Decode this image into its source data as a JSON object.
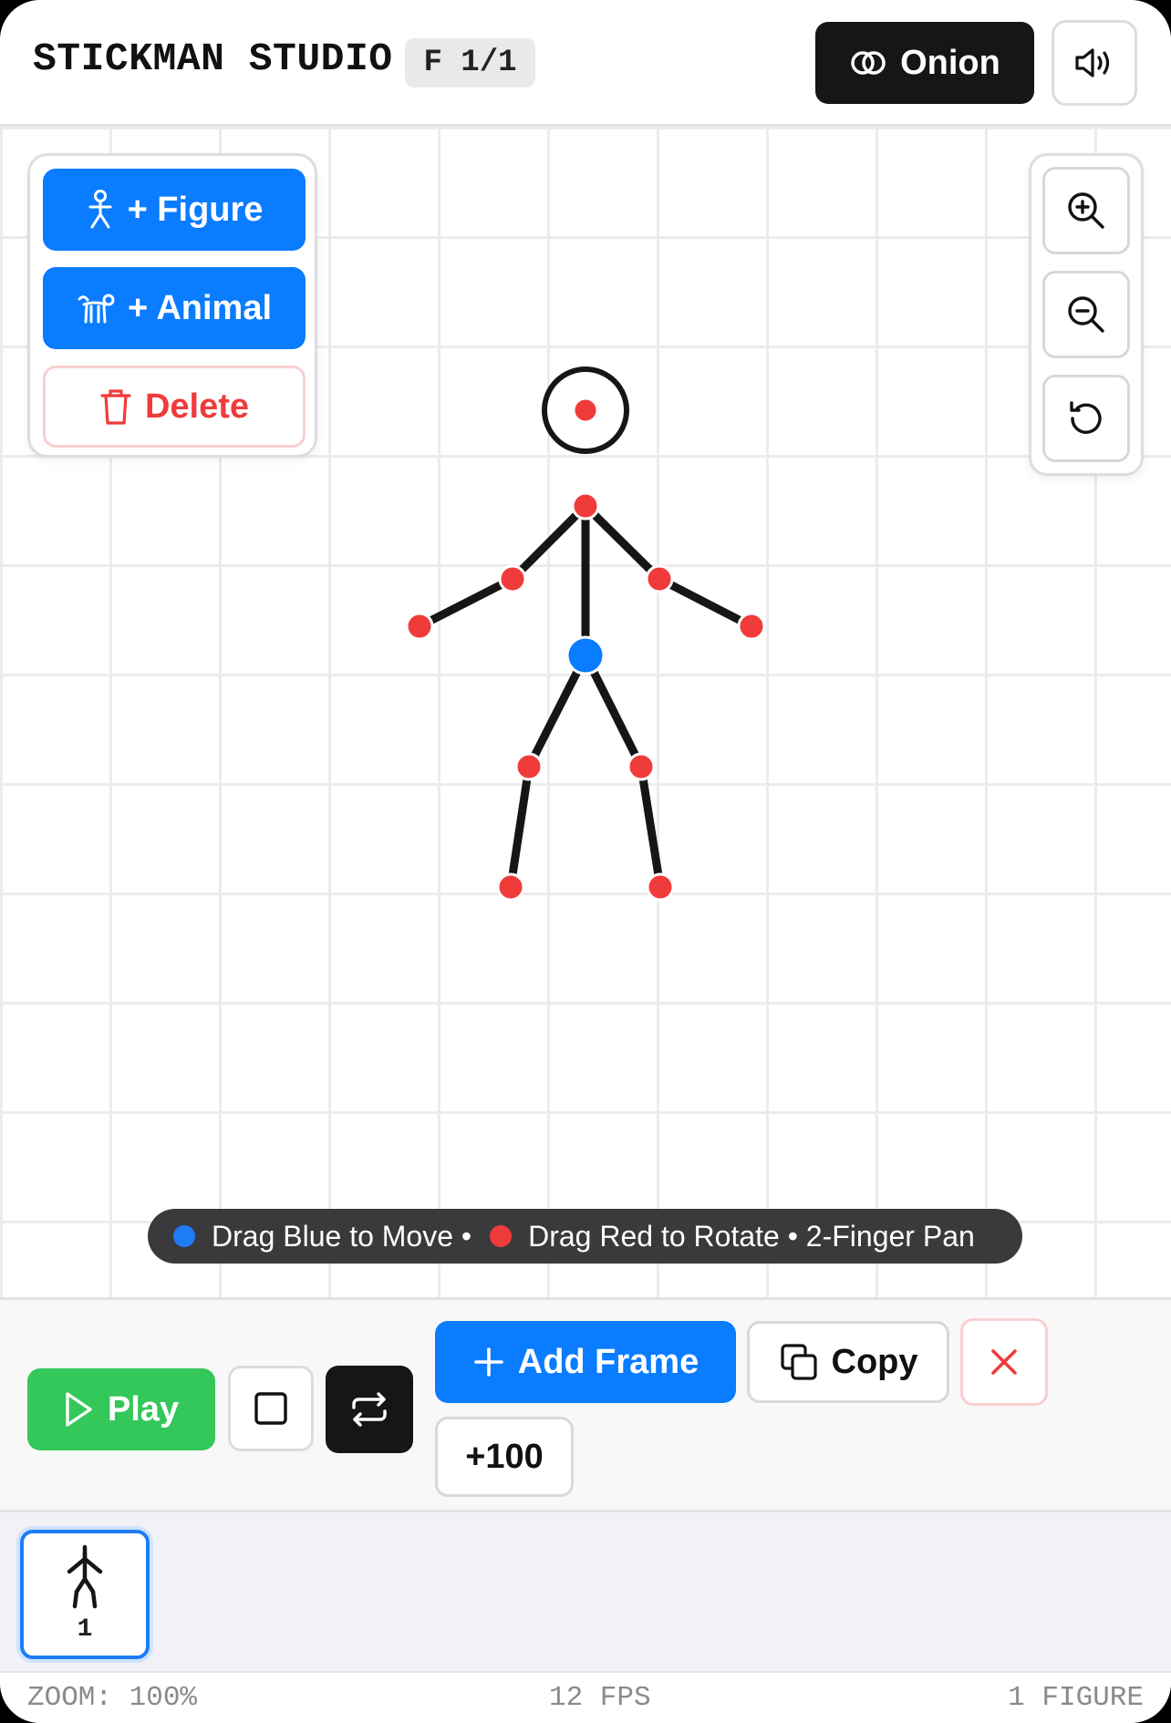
{
  "header": {
    "title": "STICKMAN STUDIO",
    "frame_indicator": "F 1/1",
    "onion_label": "Onion",
    "onion_icon": "onion-rings-icon",
    "sound_icon": "speaker-icon"
  },
  "tools": {
    "add_figure_label": "+ Figure",
    "add_animal_label": "+ Animal",
    "delete_label": "Delete"
  },
  "zoom_controls": {
    "zoom_in_icon": "zoom-in-icon",
    "zoom_out_icon": "zoom-out-icon",
    "reset_icon": "reset-icon"
  },
  "hint": {
    "move_text": "Drag Blue to Move •",
    "rotate_text": "Drag Red to Rotate • 2-Finger Pan"
  },
  "controls": {
    "play_label": "Play",
    "add_frame_label": "Add Frame",
    "copy_label": "Copy",
    "plus100_label": "+100"
  },
  "timeline": {
    "frames": [
      {
        "number": "1",
        "selected": true
      }
    ]
  },
  "status": {
    "zoom": "ZOOM: 100%",
    "fps": "12 FPS",
    "figures": "1 FIGURE"
  },
  "colors": {
    "accent_blue": "#0a7cff",
    "joint_red": "#f03b3b",
    "play_green": "#34c759",
    "dark": "#161616"
  }
}
